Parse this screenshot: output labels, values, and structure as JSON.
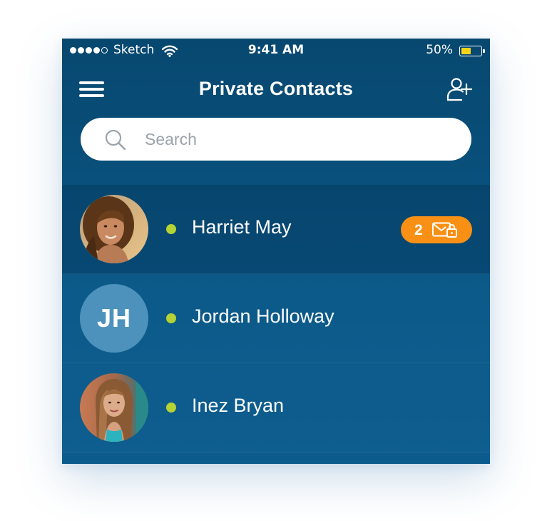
{
  "status_bar": {
    "carrier": "Sketch",
    "time": "9:41 AM",
    "battery_percent": "50%",
    "battery_level": 0.5,
    "signal_bars_filled": 4,
    "signal_bars_total": 5
  },
  "nav": {
    "title": "Private Contacts",
    "menu_icon": "hamburger-menu-icon",
    "add_icon": "add-contact-icon"
  },
  "search": {
    "placeholder": "Search",
    "value": "",
    "icon": "search-icon"
  },
  "contacts": [
    {
      "name": "Harriet May",
      "avatar_type": "photo",
      "status": "online",
      "badge_count": "2",
      "badge_icon": "locked-message-icon"
    },
    {
      "name": "Jordan Holloway",
      "avatar_type": "initials",
      "initials": "JH",
      "status": "online"
    },
    {
      "name": "Inez Bryan",
      "avatar_type": "photo",
      "status": "online"
    }
  ],
  "colors": {
    "background_top": "#07486f",
    "background_bottom": "#0c5b8d",
    "online": "#b5d334",
    "badge": "#f79015",
    "initials_avatar": "#4d92bd",
    "battery": "#f6d21b"
  }
}
